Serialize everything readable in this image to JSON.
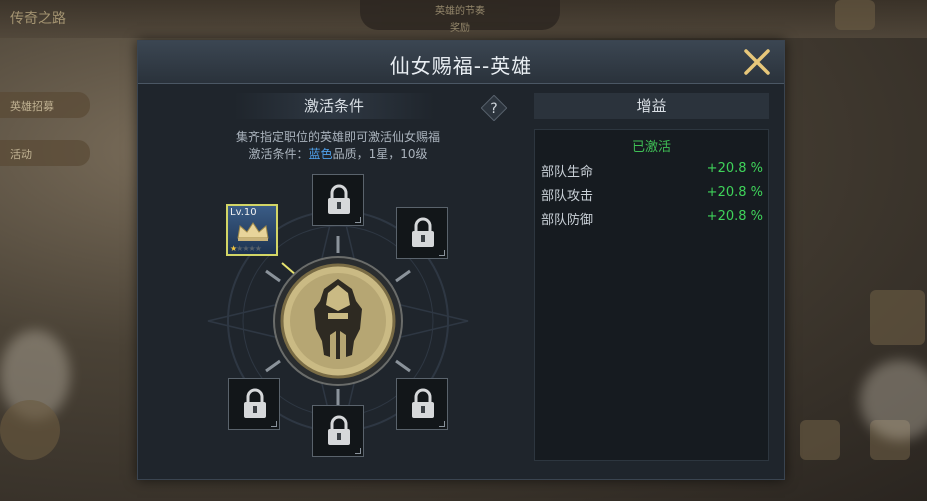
{
  "background": {
    "top_left_title": "传奇之路",
    "left_btn_1": "英雄招募",
    "left_btn_2": "活动",
    "top_center_1": "英雄的节奏",
    "top_center_2": "奖励"
  },
  "dialog": {
    "title": "仙女赐福--英雄",
    "close_icon": "close-icon",
    "left_section": "激活条件",
    "help_label": "?",
    "right_section": "增益",
    "description_line1": "集齐指定职位的英雄即可激活仙女赐福",
    "description_line2_prefix": "激活条件：",
    "description_line2_quality": "蓝色",
    "description_line2_suffix": "品质，1星，10级",
    "status": "已激活",
    "stats": [
      {
        "name": "部队生命",
        "value": "+20.8 %"
      },
      {
        "name": "部队攻击",
        "value": "+20.8 %"
      },
      {
        "name": "部队防御",
        "value": "+20.8 %"
      }
    ],
    "hero_slot": {
      "level": "Lv.10",
      "stars_filled": 1,
      "stars_total": 5
    },
    "locked_slot_icon": "lock-icon",
    "center_emblem": "spartan-helmet-emblem"
  },
  "colors": {
    "accent_green": "#3fd35a",
    "quality_blue": "#4fa0ea",
    "gold": "#c9b37a"
  }
}
